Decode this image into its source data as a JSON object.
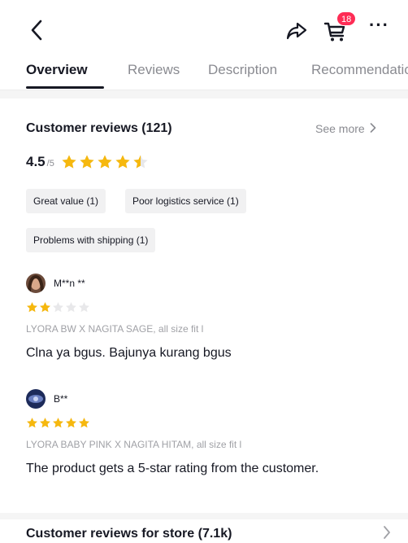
{
  "header": {
    "cart_badge": "18",
    "more_glyph": "···",
    "icons": {
      "back": "chevron-left-icon",
      "share": "share-icon",
      "cart": "cart-icon",
      "more": "more-icon"
    }
  },
  "tabs": [
    {
      "label": "Overview",
      "active": true
    },
    {
      "label": "Reviews",
      "active": false
    },
    {
      "label": "Description",
      "active": false
    },
    {
      "label": "Recommendations",
      "active": false
    }
  ],
  "reviews_section": {
    "title": "Customer reviews (121)",
    "see_more": "See more",
    "rating_value": "4.5",
    "rating_out_of": "/5",
    "rating": 4.5,
    "tags": [
      "Great value (1)",
      "Poor logistics service (1)",
      "Problems with shipping (1)"
    ]
  },
  "reviews": [
    {
      "name": "M**n **",
      "stars": 2,
      "variant": "LYORA BW X NAGITA SAGE, all size fit l",
      "text": "Clna ya bgus. Bajunya kurang bgus"
    },
    {
      "name": "B**",
      "stars": 5,
      "variant": "LYORA BABY PINK X NAGITA HITAM, all size fit l",
      "text": "The product gets a 5-star rating from the customer."
    }
  ],
  "store_reviews": {
    "label": "Customer reviews for store (7.1k)"
  },
  "colors": {
    "star_filled": "#f6b80e",
    "star_empty": "#e8e8ea",
    "badge": "#fe2c55",
    "text_primary": "#161823",
    "text_secondary": "#8a8b91"
  }
}
